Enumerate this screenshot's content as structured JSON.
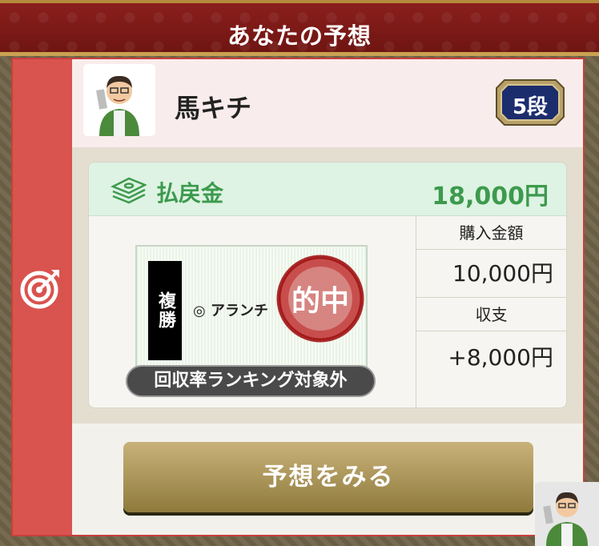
{
  "header": {
    "title": "あなたの予想"
  },
  "user": {
    "name": "馬キチ",
    "rank": "5段"
  },
  "payout": {
    "label": "払戻金",
    "value": "18,000円"
  },
  "ticket": {
    "bet_type": "複勝",
    "horse": "◎ アランチ",
    "stamp": "的中",
    "ranking_note": "回収率ランキング対象外"
  },
  "stats": {
    "purchase_label": "購入金額",
    "purchase_value": "10,000円",
    "balance_label": "収支",
    "balance_value": "+8,000円"
  },
  "actions": {
    "view_label": "予想をみる"
  },
  "icons": {
    "target": "target-icon",
    "money": "money-stack-icon",
    "stamp": "hit-stamp-icon"
  },
  "colors": {
    "banner": "#7a1816",
    "accent_red": "#d9534f",
    "payout_green": "#3c9a4d",
    "gold_button": "#a8914f"
  }
}
